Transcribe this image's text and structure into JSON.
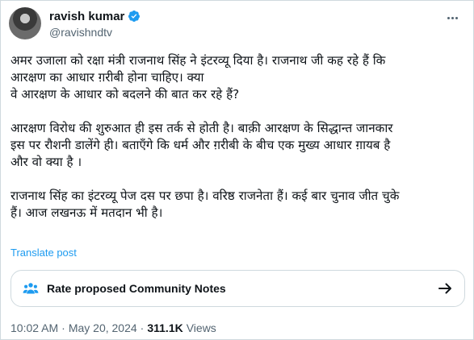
{
  "tweet": {
    "author": {
      "display_name": "ravish kumar",
      "handle": "@ravishndtv"
    },
    "paragraphs": [
      [
        "अमर उजाला को रक्षा मंत्री राजनाथ सिंह ने इंटरव्यू दिया है। राजनाथ जी कह रहे हैं कि",
        "आरक्षण का आधार ग़रीबी होना चाहिए। क्या",
        "वे आरक्षण के आधार को बदलने की बात कर रहे हैं?"
      ],
      [
        "आरक्षण विरोध की शुरुआत ही इस तर्क से होती है। बाक़ी आरक्षण के सिद्धान्त जानकार",
        "इस पर रौशनी डालेंगे ही। बताएँगे कि धर्म और ग़रीबी के बीच एक मुख्य आधार ग़ायब है",
        "और वो क्या है ।"
      ],
      [
        "राजनाथ सिंह का इंटरव्यू पेज दस पर छपा है। वरिष्ठ राजनेता हैं। कई बार चुनाव जीत चुके",
        "हैं। आज लखनऊ में मतदान भी है।"
      ]
    ],
    "translate_label": "Translate post",
    "community_notes_label": "Rate proposed Community Notes",
    "time": "10:02 AM",
    "separator": "·",
    "date": "May 20, 2024",
    "views_count": "311.1K",
    "views_label": "Views"
  },
  "colors": {
    "accent": "#1d9bf0",
    "text": "#0f1419",
    "muted": "#536471",
    "border": "#cfd9de"
  },
  "icons": {
    "verified": "verified-badge-icon",
    "more": "more-icon",
    "notes": "people-icon",
    "arrow": "arrow-right-icon"
  }
}
